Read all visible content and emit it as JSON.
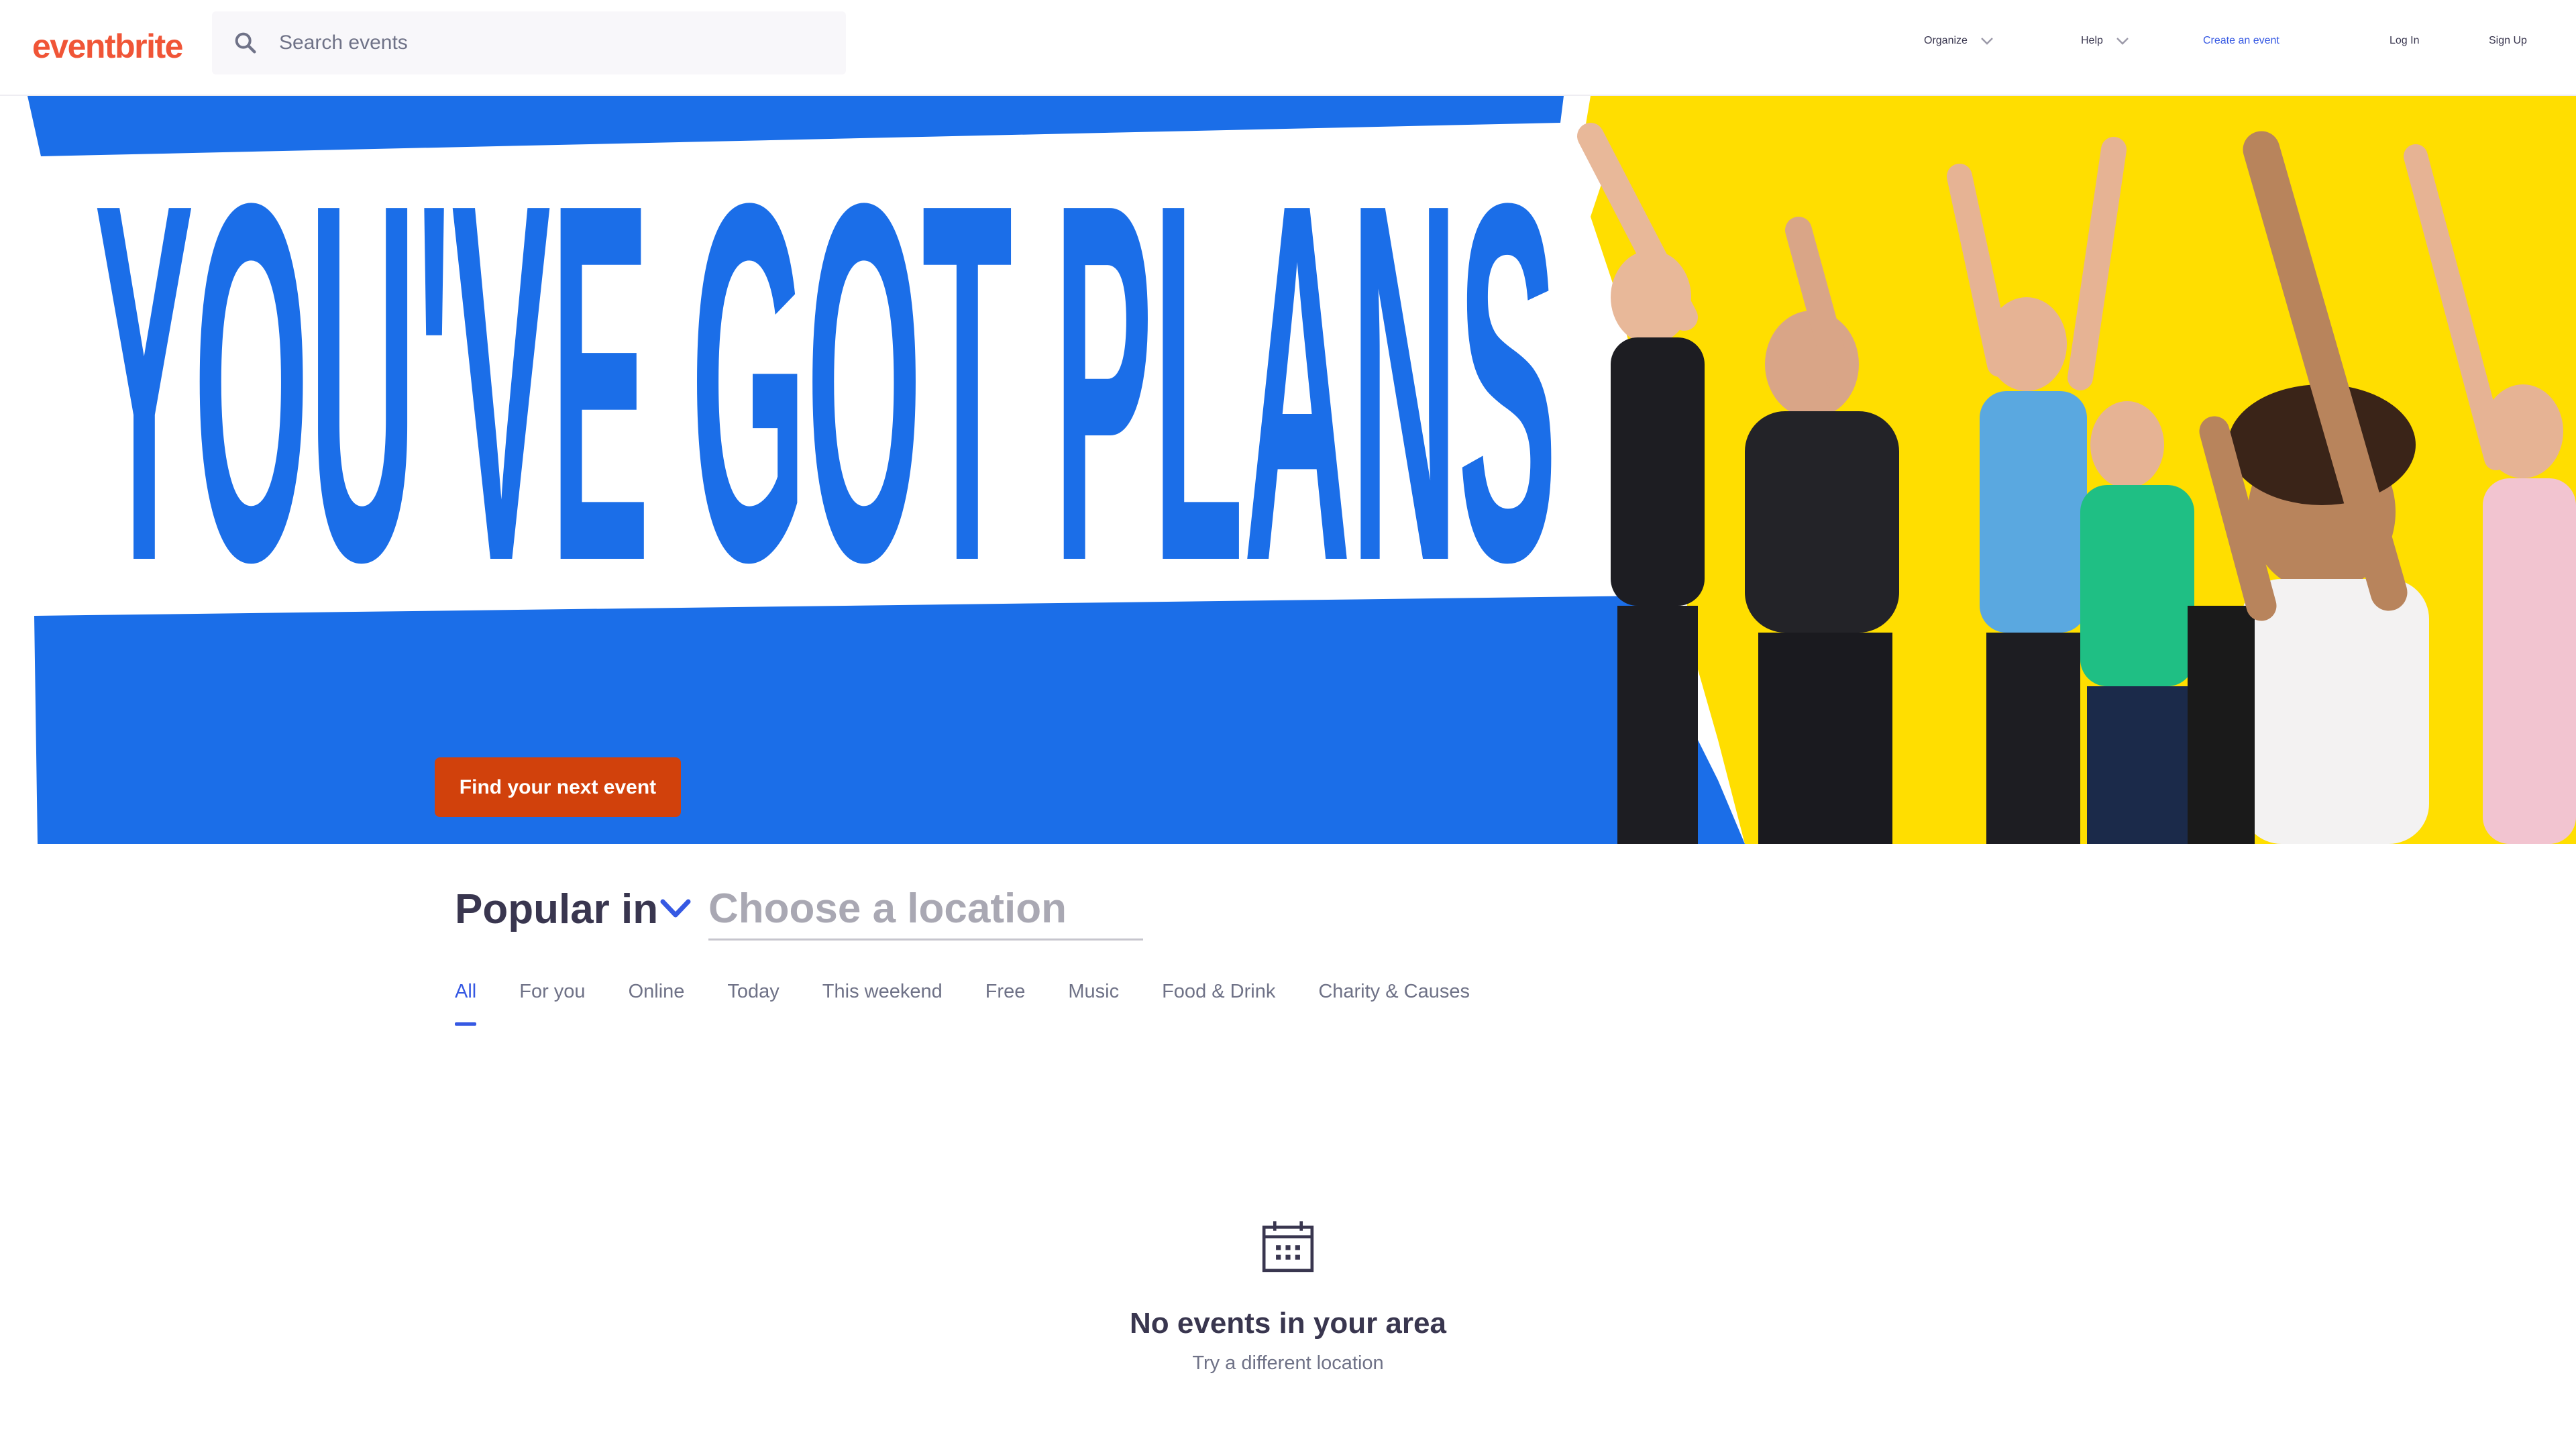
{
  "brand": {
    "logo_text": "eventbrite",
    "logo_color": "#f05537",
    "accent": "#3659e3",
    "cta_color": "#d1410c"
  },
  "search": {
    "placeholder": "Search events",
    "icon": "search-icon"
  },
  "nav": {
    "organize": "Organize",
    "help": "Help",
    "create_event": "Create an event",
    "log_in": "Log In",
    "sign_up": "Sign Up"
  },
  "hero": {
    "headline": "YOU'VE GOT PLANS",
    "cta": "Find your next event",
    "headline_color": "#1b6ee8",
    "photo_bg_color": "#ffde00"
  },
  "popular": {
    "title": "Popular in",
    "location_placeholder": "Choose a location",
    "tabs": [
      {
        "label": "All",
        "active": true
      },
      {
        "label": "For you",
        "active": false
      },
      {
        "label": "Online",
        "active": false
      },
      {
        "label": "Today",
        "active": false
      },
      {
        "label": "This weekend",
        "active": false
      },
      {
        "label": "Free",
        "active": false
      },
      {
        "label": "Music",
        "active": false
      },
      {
        "label": "Food & Drink",
        "active": false
      },
      {
        "label": "Charity & Causes",
        "active": false
      }
    ]
  },
  "empty_state": {
    "icon": "calendar-icon",
    "title": "No events in your area",
    "subtitle": "Try a different location"
  }
}
